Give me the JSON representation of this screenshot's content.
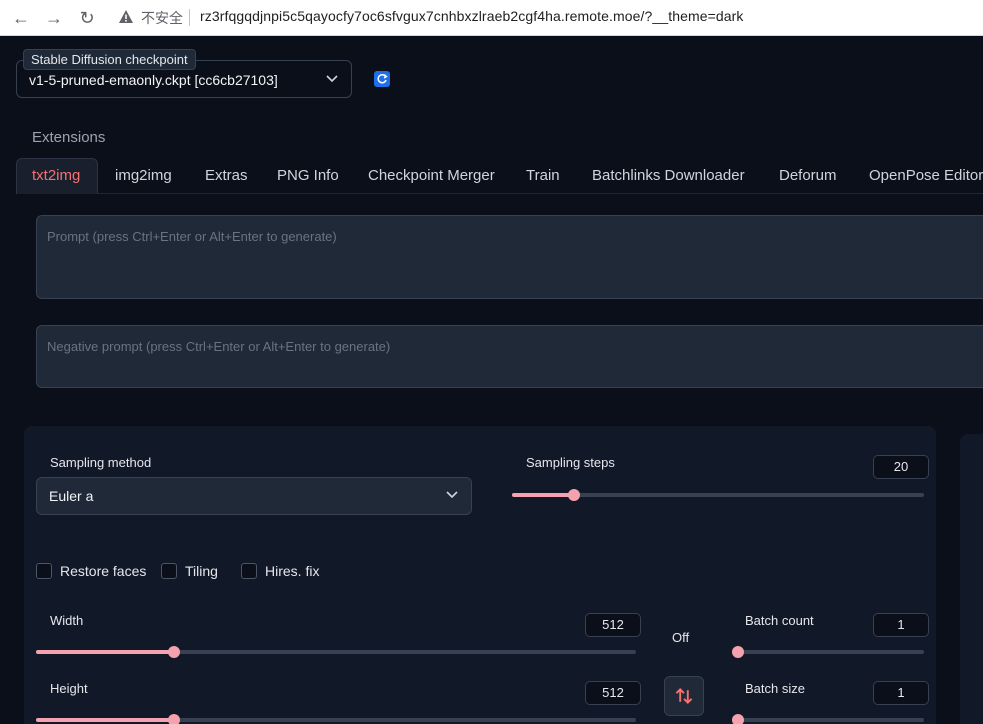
{
  "browser": {
    "insecure_label": "不安全",
    "url": "rz3rfqgqdjnpi5c5qayocfy7oc6sfvgux7cnhbxzlraeb2cgf4ha.remote.moe/?__theme=dark"
  },
  "checkpoint": {
    "label": "Stable Diffusion checkpoint",
    "value": "v1-5-pruned-emaonly.ckpt [cc6cb27103]"
  },
  "extensions_label": "Extensions",
  "tabs": [
    {
      "label": "txt2img",
      "active": true
    },
    {
      "label": "img2img"
    },
    {
      "label": "Extras"
    },
    {
      "label": "PNG Info"
    },
    {
      "label": "Checkpoint Merger"
    },
    {
      "label": "Train"
    },
    {
      "label": "Batchlinks Downloader"
    },
    {
      "label": "Deforum"
    },
    {
      "label": "OpenPose Editor"
    }
  ],
  "prompt": {
    "placeholder": "Prompt (press Ctrl+Enter or Alt+Enter to generate)"
  },
  "negative_prompt": {
    "placeholder": "Negative prompt (press Ctrl+Enter or Alt+Enter to generate)"
  },
  "sampling": {
    "method_label": "Sampling method",
    "method_value": "Euler a",
    "steps_label": "Sampling steps",
    "steps_value": "20",
    "steps_fraction": 0.15
  },
  "options": {
    "restore_faces": "Restore faces",
    "tiling": "Tiling",
    "hires_fix": "Hires. fix"
  },
  "size": {
    "width_label": "Width",
    "width_value": "512",
    "width_fraction": 0.23,
    "height_label": "Height",
    "height_value": "512",
    "height_fraction": 0.23,
    "off_label": "Off"
  },
  "batch": {
    "count_label": "Batch count",
    "count_value": "1",
    "size_label": "Batch size",
    "size_value": "1"
  },
  "colors": {
    "accent": "#f4a2ad",
    "active_tab": "#f87171",
    "background": "#0b0f19"
  }
}
